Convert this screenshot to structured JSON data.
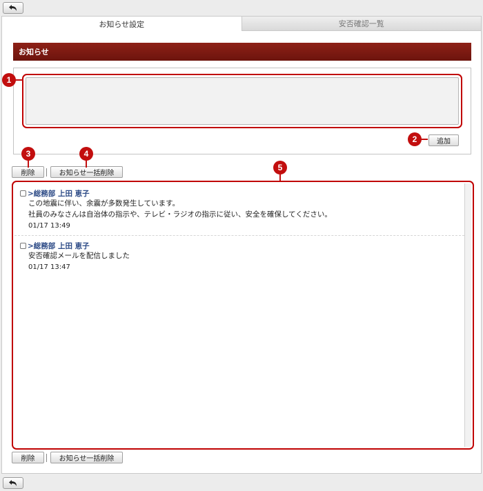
{
  "tabs": [
    {
      "label": "お知らせ設定",
      "active": true
    },
    {
      "label": "安否確認一覧",
      "active": false
    }
  ],
  "section_title": "お知らせ",
  "buttons": {
    "add": "追加",
    "delete": "削除",
    "delete_all": "お知らせ一括削除"
  },
  "badges": [
    "1",
    "2",
    "3",
    "4",
    "5"
  ],
  "messages": [
    {
      "author": ">総務部 上田 恵子",
      "lines": [
        "この地震に伴い、余震が多数発生しています。",
        "社員のみなさんは自治体の指示や、テレビ・ラジオの指示に従い、安全を確保してください。"
      ],
      "time": "01/17 13:49"
    },
    {
      "author": ">総務部 上田 恵子",
      "lines": [
        "安否確認メールを配信しました"
      ],
      "time": "01/17 13:47"
    }
  ],
  "colors": {
    "section_bar": "#7a1a10",
    "annotation": "#c20e0e",
    "author_text": "#2c4a86"
  },
  "icons": {
    "back": "back-arrow-icon"
  }
}
